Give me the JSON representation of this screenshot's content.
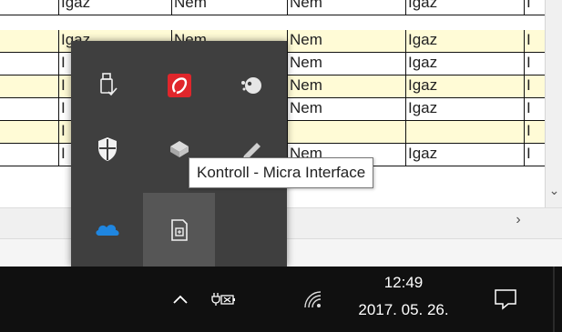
{
  "table": {
    "rows": [
      [
        "Igaz",
        "Nem",
        "Nem",
        "Igaz",
        "I"
      ],
      [
        "Igaz",
        "Nem",
        "Nem",
        "Igaz",
        "I"
      ],
      [
        "I",
        "",
        "Nem",
        "Igaz",
        "I"
      ],
      [
        "I",
        "",
        "Nem",
        "Igaz",
        "I"
      ],
      [
        "I",
        "",
        "Nem",
        "Igaz",
        "I"
      ],
      [
        "I",
        "",
        "",
        "",
        "I"
      ],
      [
        "I",
        "",
        "Nem",
        "Igaz",
        "I"
      ]
    ]
  },
  "tray_flyout": {
    "icons": [
      {
        "icon": "usb-safely-remove-icon"
      },
      {
        "icon": "red-app-icon"
      },
      {
        "icon": "network-blob-icon"
      },
      {
        "icon": "windows-security-shield-icon"
      },
      {
        "icon": "kontroll-micra-interface-icon"
      },
      {
        "icon": "pencil-tool-icon"
      },
      {
        "icon": "onedrive-cloud-icon"
      },
      {
        "icon": "document-app-icon"
      }
    ]
  },
  "tooltip": {
    "text": "Kontroll - Micra Interface"
  },
  "taskbar": {
    "time": "12:49",
    "date": "2017. 05. 26.",
    "show_hidden_icon": "chevron-up-icon",
    "power_icon": "power-plug-icon",
    "network_icon": "wifi-icon",
    "action_center_icon": "notification-icon"
  },
  "colors": {
    "taskbar_bg": "#101010",
    "flyout_bg": "#3f3f3f",
    "row_alt": "#fffbd6",
    "accent_red": "#e0262b",
    "onedrive_blue": "#1f86e0"
  }
}
